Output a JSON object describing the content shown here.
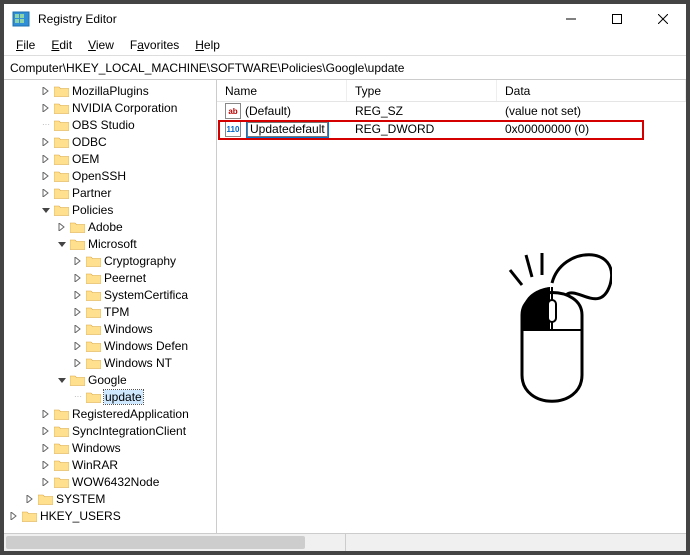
{
  "window": {
    "title": "Registry Editor"
  },
  "menu": {
    "file": "File",
    "edit": "Edit",
    "view": "View",
    "favorites": "Favorites",
    "help": "Help"
  },
  "address": "Computer\\HKEY_LOCAL_MACHINE\\SOFTWARE\\Policies\\Google\\update",
  "list": {
    "headers": {
      "name": "Name",
      "type": "Type",
      "data": "Data"
    },
    "rows": [
      {
        "icon": "sz",
        "name": "(Default)",
        "type": "REG_SZ",
        "data": "(value not set)",
        "editing": false
      },
      {
        "icon": "dw",
        "name": "Updatedefault",
        "type": "REG_DWORD",
        "data": "0x00000000 (0)",
        "editing": true
      }
    ]
  },
  "tree": {
    "nodes": [
      {
        "d": 2,
        "exp": ">",
        "label": "MozillaPlugins"
      },
      {
        "d": 2,
        "exp": ">",
        "label": "NVIDIA Corporation"
      },
      {
        "d": 2,
        "exp": "·",
        "label": "OBS Studio"
      },
      {
        "d": 2,
        "exp": ">",
        "label": "ODBC"
      },
      {
        "d": 2,
        "exp": ">",
        "label": "OEM"
      },
      {
        "d": 2,
        "exp": ">",
        "label": "OpenSSH"
      },
      {
        "d": 2,
        "exp": ">",
        "label": "Partner"
      },
      {
        "d": 2,
        "exp": "v",
        "label": "Policies"
      },
      {
        "d": 3,
        "exp": ">",
        "label": "Adobe"
      },
      {
        "d": 3,
        "exp": "v",
        "label": "Microsoft"
      },
      {
        "d": 4,
        "exp": ">",
        "label": "Cryptography"
      },
      {
        "d": 4,
        "exp": ">",
        "label": "Peernet"
      },
      {
        "d": 4,
        "exp": ">",
        "label": "SystemCertifica"
      },
      {
        "d": 4,
        "exp": ">",
        "label": "TPM"
      },
      {
        "d": 4,
        "exp": ">",
        "label": "Windows"
      },
      {
        "d": 4,
        "exp": ">",
        "label": "Windows Defen"
      },
      {
        "d": 4,
        "exp": ">",
        "label": "Windows NT"
      },
      {
        "d": 3,
        "exp": "v",
        "label": "Google"
      },
      {
        "d": 4,
        "exp": "·",
        "label": "update",
        "selected": true
      },
      {
        "d": 2,
        "exp": ">",
        "label": "RegisteredApplication"
      },
      {
        "d": 2,
        "exp": ">",
        "label": "SyncIntegrationClient"
      },
      {
        "d": 2,
        "exp": ">",
        "label": "Windows"
      },
      {
        "d": 2,
        "exp": ">",
        "label": "WinRAR"
      },
      {
        "d": 2,
        "exp": ">",
        "label": "WOW6432Node"
      },
      {
        "d": 1,
        "exp": ">",
        "label": "SYSTEM"
      },
      {
        "d": 0,
        "exp": ">",
        "label": "HKEY_USERS"
      }
    ]
  },
  "icons": {
    "sz_text": "ab",
    "dw_text": "011\n110"
  }
}
